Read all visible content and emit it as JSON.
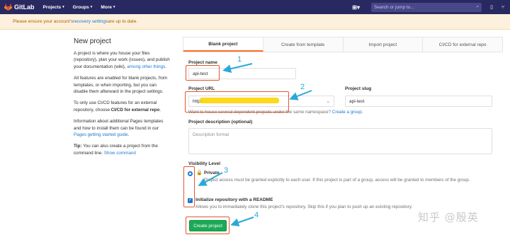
{
  "nav": {
    "logo_text": "GitLab",
    "menu": [
      "Projects",
      "Groups",
      "More"
    ],
    "search_placeholder": "Search or jump to..."
  },
  "banner": {
    "prefix": "Please ensure your account's ",
    "link": "recovery settings",
    "suffix": " are up to date."
  },
  "left": {
    "title": "New project",
    "p1_text": "A project is where you house your files (repository), plan your work (issues), and publish your documentation (wiki), ",
    "p1_link": "among other things",
    "p1_end": ".",
    "p2": "All features are enabled for blank projects, from templates, or when importing, but you can disable them afterward in the project settings.",
    "p3_text": "To only use CI/CD features for an external repository, choose ",
    "p3_bold": "CI/CD for external repo",
    "p3_end": ".",
    "p4_text": "Information about additional Pages templates and how to install them can be found in our ",
    "p4_link": "Pages getting started guide",
    "p4_end": ".",
    "tip_bold": "Tip:",
    "tip_text": " You can also create a project from the command line. ",
    "tip_link": "Show command"
  },
  "tabs": [
    "Blank project",
    "Create from template",
    "Import project",
    "CI/CD for external repo"
  ],
  "form": {
    "project_name_label": "Project name",
    "project_name_value": "api-test",
    "project_url_label": "Project URL",
    "project_url_prefix": "https",
    "project_slug_label": "Project slug",
    "project_slug_value": "api-test",
    "namespace_help": "Want to house several dependent projects under the same namespace? ",
    "namespace_link": "Create a group.",
    "description_label": "Project description (optional)",
    "description_placeholder": "Description format",
    "visibility_label": "Visibility Level",
    "private_label": "Private",
    "private_desc": "Project access must be granted explicitly to each user. If this project is part of a group, access will be granted to members of the group.",
    "readme_label": "Initialize repository with a README",
    "readme_desc": "Allows you to immediately clone this project's repository. Skip this if you plan to push up an existing repository.",
    "create_button": "Create project"
  },
  "annotations": [
    "1",
    "2",
    "3",
    "4"
  ],
  "watermark": "知乎 @殷英",
  "colors": {
    "navbar": "#292961",
    "accent_orange": "#fc6d26",
    "primary_blue": "#1f78d1",
    "success_green": "#1aaa55",
    "annotation_red": "#e4572e",
    "annotation_blue": "#29a9d9",
    "highlight_yellow": "#ffd400"
  }
}
